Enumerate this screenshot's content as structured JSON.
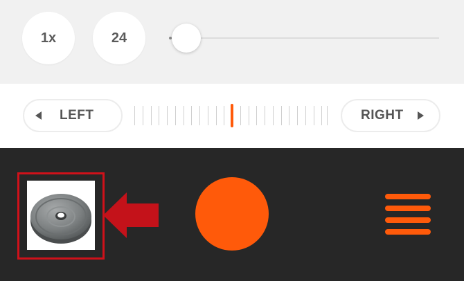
{
  "top_bar": {
    "speed_label": "1x",
    "count_label": "24",
    "slider": {
      "value_fraction": 0.02
    }
  },
  "direction_bar": {
    "left_label": "LEFT",
    "right_label": "RIGHT",
    "tick_count": 25,
    "active_tick_index": 12
  },
  "bottom_bar": {
    "thumbnail_icon": "weight-plate-icon",
    "annotation_icon": "red-arrow-icon",
    "record_icon": "record-button",
    "menu_icon": "hamburger-menu-icon"
  },
  "colors": {
    "accent": "#ff5a0a",
    "annotation": "#d0111a",
    "dark_bg": "#272727",
    "light_bg": "#f1f1f1"
  }
}
